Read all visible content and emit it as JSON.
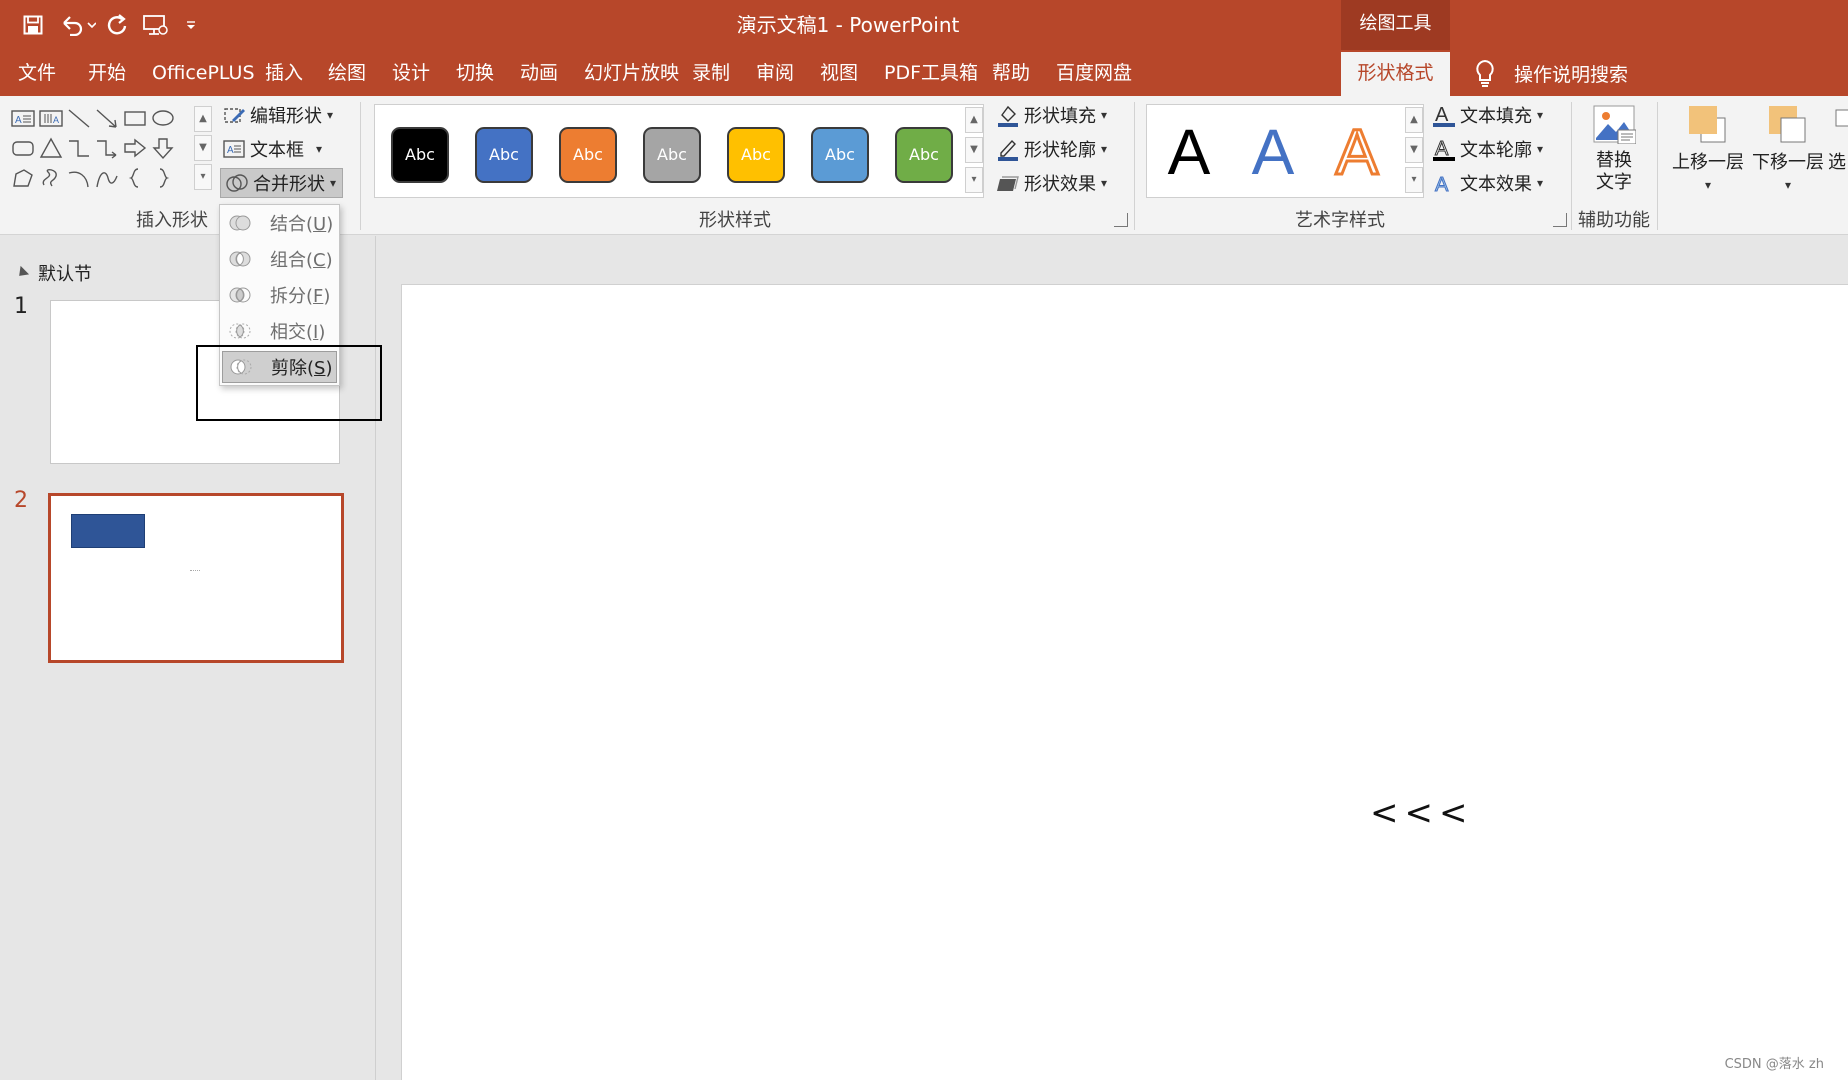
{
  "titlebar": {
    "title": "演示文稿1  -  PowerPoint",
    "context_tool": "绘图工具",
    "qat": [
      "save-icon",
      "undo-icon",
      "redo-icon",
      "present-icon",
      "customize-qat-icon"
    ]
  },
  "tabs": [
    "文件",
    "开始",
    "OfficePLUS",
    "插入",
    "绘图",
    "设计",
    "切换",
    "动画",
    "幻灯片放映",
    "录制",
    "审阅",
    "视图",
    "PDF工具箱",
    "帮助",
    "百度网盘",
    "形状格式"
  ],
  "tell_me": "操作说明搜索",
  "ribbon": {
    "insert_shapes": {
      "label": "插入形状",
      "edit_shape": "编辑形状",
      "text_box": "文本框",
      "merge_shapes": "合并形状"
    },
    "shape_styles": {
      "label": "形状样式",
      "preset_text": "Abc",
      "presets": [
        "#000000",
        "#4472c4",
        "#ed7d31",
        "#a5a5a5",
        "#ffc000",
        "#5b9bd5",
        "#70ad47"
      ],
      "fill": "形状填充",
      "outline": "形状轮廓",
      "effects": "形状效果"
    },
    "wordart": {
      "label": "艺术字样式",
      "letter": "A",
      "text_fill": "文本填充",
      "text_outline": "文本轮廓",
      "text_effects": "文本效果"
    },
    "accessibility": {
      "label": "辅助功能",
      "alt_text_line1": "替换",
      "alt_text_line2": "文字"
    },
    "arrange": {
      "bring_forward": "上移一层",
      "send_backward": "下移一层",
      "selection": "选"
    }
  },
  "merge_menu": [
    {
      "label": "结合",
      "key": "U"
    },
    {
      "label": "组合",
      "key": "C"
    },
    {
      "label": "拆分",
      "key": "F"
    },
    {
      "label": "相交",
      "key": "I"
    },
    {
      "label": "剪除",
      "key": "S"
    }
  ],
  "left_pane": {
    "section": "默认节",
    "slide1_num": "1",
    "slide2_num": "2"
  },
  "slide": {
    "text": "<<<"
  },
  "colors": {
    "accent": "#b7472a",
    "shape_fill": "#2f5597"
  },
  "watermark": "CSDN @落水 zh"
}
